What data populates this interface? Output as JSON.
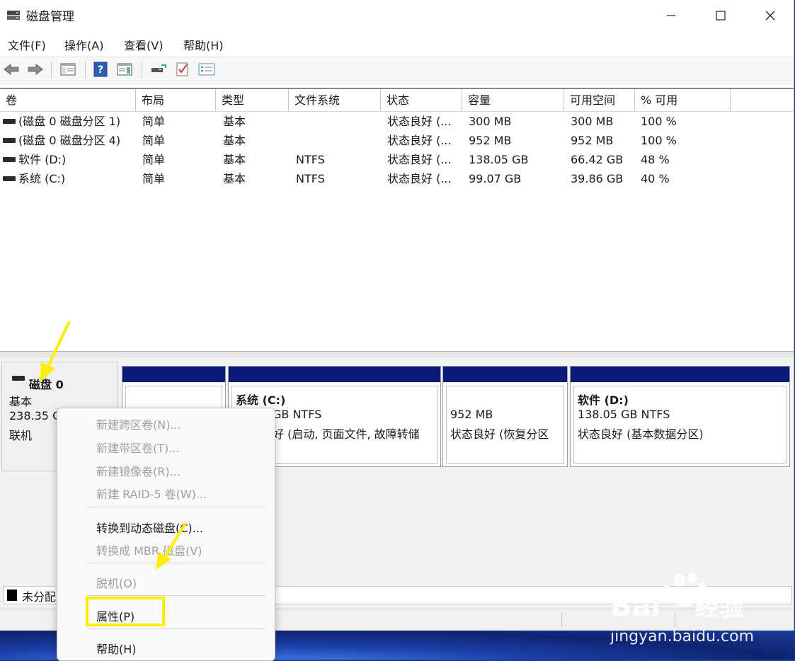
{
  "window": {
    "title": "磁盘管理",
    "controls": {
      "minimize": "—",
      "maximize": "☐",
      "close": "✕"
    }
  },
  "menubar": [
    "文件(F)",
    "操作(A)",
    "查看(V)",
    "帮助(H)"
  ],
  "toolbar": {
    "icons": [
      "back-arrow-icon",
      "forward-arrow-icon",
      "console-tree-icon",
      "help-icon",
      "show-pane-icon",
      "connect-disk-icon",
      "checklist-icon",
      "properties-list-icon"
    ]
  },
  "table": {
    "columns": [
      "卷",
      "布局",
      "类型",
      "文件系统",
      "状态",
      "容量",
      "可用空间",
      "% 可用"
    ],
    "rows": [
      [
        "(磁盘 0 磁盘分区 1)",
        "简单",
        "基本",
        "",
        "状态良好 (...",
        "300 MB",
        "300 MB",
        "100 %"
      ],
      [
        "(磁盘 0 磁盘分区 4)",
        "简单",
        "基本",
        "",
        "状态良好 (...",
        "952 MB",
        "952 MB",
        "100 %"
      ],
      [
        "软件 (D:)",
        "简单",
        "基本",
        "NTFS",
        "状态良好 (...",
        "138.05 GB",
        "66.42 GB",
        "48 %"
      ],
      [
        "系统 (C:)",
        "简单",
        "基本",
        "NTFS",
        "状态良好 (...",
        "99.07 GB",
        "39.86 GB",
        "40 %"
      ]
    ]
  },
  "disk": {
    "name": "磁盘 0",
    "type": "基本",
    "size": "238.35 G",
    "status": "联机",
    "partitions": [
      {
        "name": "",
        "line1": "",
        "line2": ""
      },
      {
        "name": "系统 (C:)",
        "line1": "GB NTFS",
        "line2": "好 (启动, 页面文件, 故障转储"
      },
      {
        "name": "",
        "line1": "952 MB",
        "line2": "状态良好 (恢复分区"
      },
      {
        "name": "软件 (D:)",
        "line1": "138.05 GB NTFS",
        "line2": "状态良好 (基本数据分区)"
      }
    ],
    "legend_unallocated": "未分配"
  },
  "context_menu": {
    "items": [
      {
        "label": "新建跨区卷(N)...",
        "enabled": false
      },
      {
        "label": "新建带区卷(T)...",
        "enabled": false
      },
      {
        "label": "新建镜像卷(R)...",
        "enabled": false
      },
      {
        "label": "新建 RAID-5 卷(W)...",
        "enabled": false
      },
      {
        "label": "转换到动态磁盘(C)...",
        "enabled": true
      },
      {
        "label": "转换成 MBR 磁盘(V)",
        "enabled": false
      },
      {
        "label": "脱机(O)",
        "enabled": false
      },
      {
        "label": "属性(P)",
        "enabled": true
      },
      {
        "label": "帮助(H)",
        "enabled": true
      }
    ]
  },
  "colors": {
    "partition_header": "#0a1a7a",
    "highlight": "#ffee00",
    "annotation_arrow": "#ffee00"
  },
  "watermark": {
    "brand": "Baidu",
    "cn": "经验",
    "url": "jingyan.baidu.com"
  }
}
